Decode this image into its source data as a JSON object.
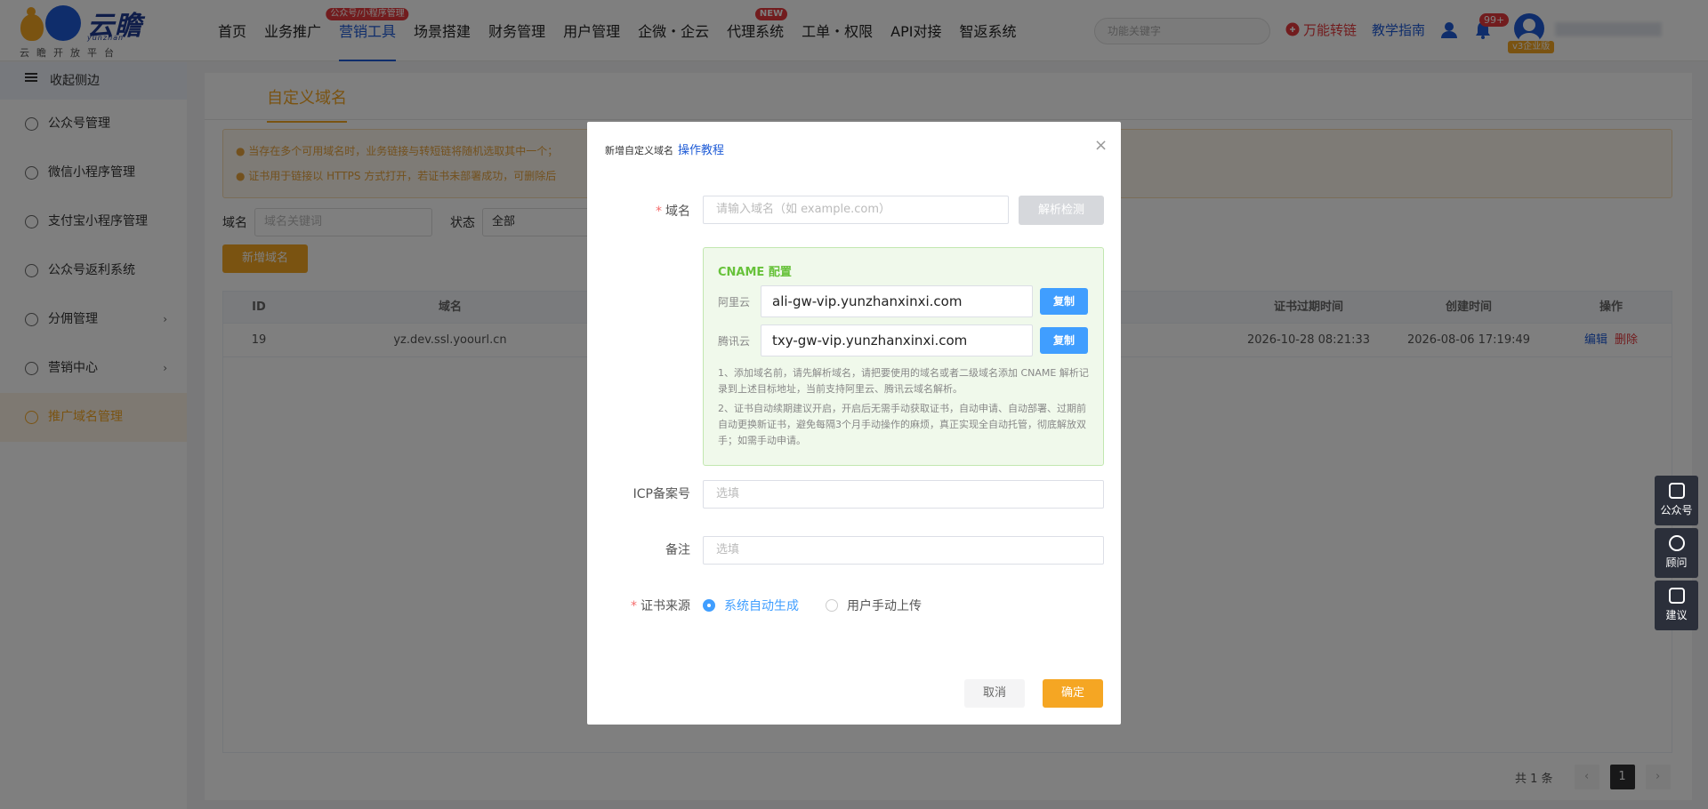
{
  "header": {
    "logo_name": "云瞻",
    "logo_sub": "yunzhan",
    "logo_slogan": "云瞻开放平台",
    "nav": [
      {
        "label": "首页"
      },
      {
        "label": "业务推广"
      },
      {
        "label": "营销工具",
        "badge": "公众号/小程序管理",
        "active": true
      },
      {
        "label": "场景搭建"
      },
      {
        "label": "财务管理"
      },
      {
        "label": "用户管理"
      },
      {
        "label": "企微・企云"
      },
      {
        "label": "代理系统",
        "badge": "NEW"
      },
      {
        "label": "工单・权限"
      },
      {
        "label": "API对接"
      },
      {
        "label": "智返系统"
      }
    ],
    "search_placeholder": "功能关键字",
    "link_wanneng": "万能转链",
    "link_guide": "教学指南",
    "notif_count": "99+",
    "vip_badge": "v3企业版",
    "accent": "#1e5bd6",
    "orange": "#f5a623"
  },
  "sidebar": {
    "collapse_label": "收起侧边",
    "items": [
      {
        "label": "公众号管理",
        "icon": "wechat-icon"
      },
      {
        "label": "微信小程序管理",
        "icon": "miniapp-icon"
      },
      {
        "label": "支付宝小程序管理",
        "icon": "alipay-icon"
      },
      {
        "label": "公众号返利系统",
        "icon": "yen-icon"
      },
      {
        "label": "分佣管理",
        "icon": "commission-icon",
        "arrow": "›"
      },
      {
        "label": "营销中心",
        "icon": "gift-icon",
        "arrow": "›"
      },
      {
        "label": "推广域名管理",
        "icon": "globe-icon",
        "active": true
      }
    ]
  },
  "main": {
    "tab": "自定义域名",
    "warn1": "当存在多个可用域名时，业务链接与转短链将随机选取其中一个；",
    "warn2": "证书用于链接以 HTTPS 方式打开，若证书未部署成功，可删除后",
    "filter_domain_label": "域名",
    "filter_domain_placeholder": "域名关键词",
    "filter_status_label": "状态",
    "filter_status_value": "全部",
    "add_button": "新增域名",
    "columns": {
      "id": "ID",
      "domain": "域名",
      "cert_expire": "证书过期时间",
      "created": "创建时间",
      "ops": "操作"
    },
    "rows": [
      {
        "id": "19",
        "domain": "yz.dev.ssl.yoourl.cn",
        "cert_expire": "2026-10-28 08:21:33",
        "created": "2026-08-06 17:19:49",
        "edit": "编辑",
        "delete": "删除"
      }
    ],
    "pager_total": "共 1 条",
    "pager_prev": "‹",
    "pager_current": "1",
    "pager_next": "›"
  },
  "float": [
    {
      "label": "公众号",
      "icon": "chat-icon"
    },
    {
      "label": "顾问",
      "icon": "headset-icon"
    },
    {
      "label": "建议",
      "icon": "edit-icon"
    }
  ],
  "dialog": {
    "title": "新增自定义域名",
    "tutorial_link": "操作教程",
    "close": "×",
    "domain_label": "域名",
    "domain_placeholder": "请输入域名（如 example.com）",
    "detect_button": "解析检测",
    "cname_title": "CNAME 配置",
    "aliyun_label": "阿里云",
    "aliyun_value": "ali-gw-vip.yunzhanxinxi.com",
    "tencent_label": "腾讯云",
    "tencent_value": "txy-gw-vip.yunzhanxinxi.com",
    "copy_label": "复制",
    "note1": "1、添加域名前，请先解析域名，请把要使用的域名或者二级域名添加 CNAME 解析记录到上述目标地址，当前支持阿里云、腾讯云域名解析。",
    "note2": "2、证书自动续期建议开启，开启后无需手动获取证书，自动申请、自动部署、过期前自动更换新证书，避免每隔3个月手动操作的麻烦，真正实现全自动托管，彻底解放双手；如需手动申请。",
    "icp_label": "ICP备案号",
    "icp_placeholder": "选填",
    "remark_label": "备注",
    "remark_placeholder": "选填",
    "cert_label": "证书来源",
    "cert_opt_auto": "系统自动生成",
    "cert_opt_manual": "用户手动上传",
    "cancel": "取消",
    "confirm": "确定"
  }
}
